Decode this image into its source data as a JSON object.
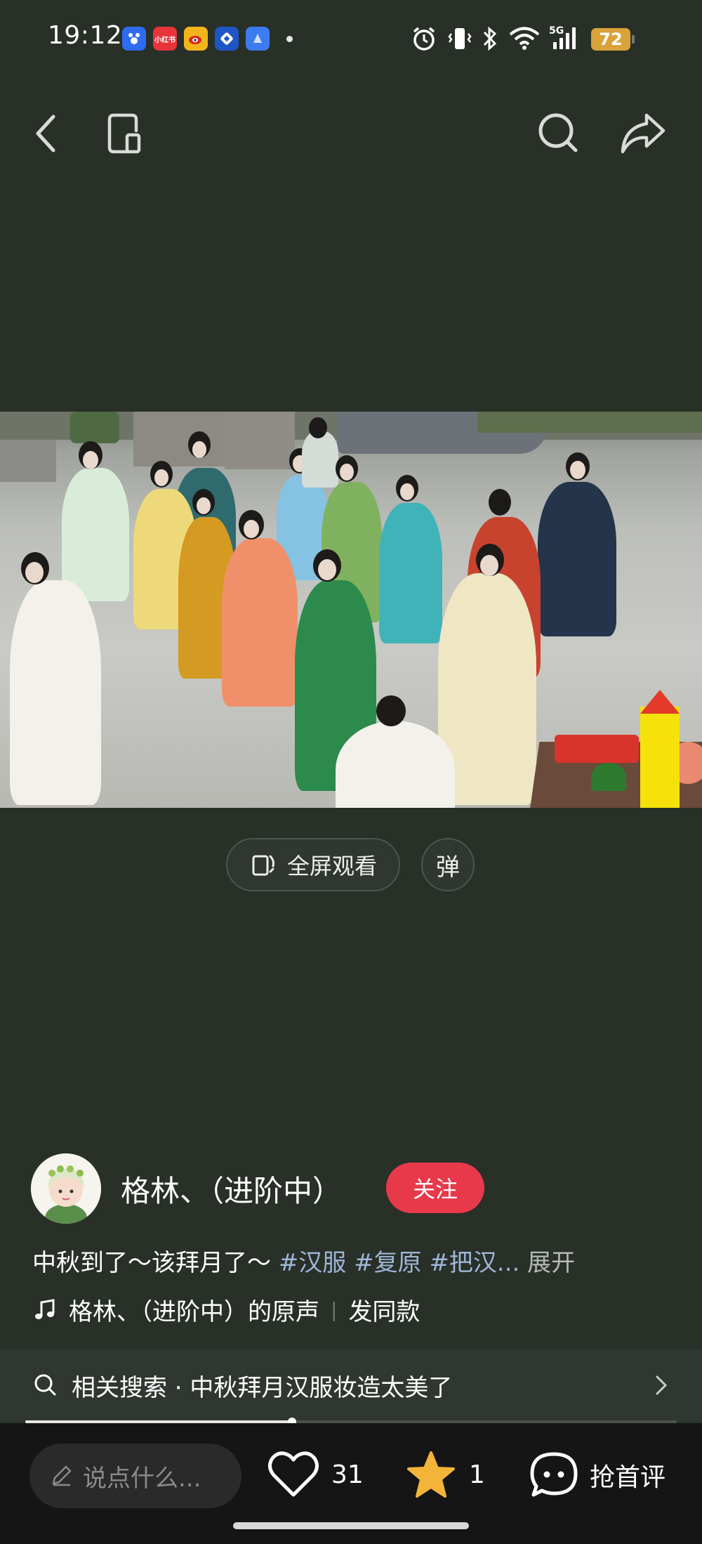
{
  "status_bar": {
    "time": "19:12",
    "battery": "72",
    "apps": [
      {
        "name": "baidu-app-icon",
        "label": "",
        "color": "#2f6bf0"
      },
      {
        "name": "xiaohongshu-app-icon",
        "label": "小红书",
        "color": "#e8333a"
      },
      {
        "name": "weibo-app-icon",
        "label": "",
        "color": "#f2b51b"
      },
      {
        "name": "ctrip-app-icon",
        "label": "",
        "color": "#1f56c6"
      },
      {
        "name": "blue-app-icon",
        "label": "",
        "color": "#3c7cf0"
      }
    ]
  },
  "nav": {
    "back_icon": "chevron-left-icon",
    "mini_window_icon": "mini-window-icon",
    "search_icon": "search-icon",
    "share_icon": "share-icon"
  },
  "player": {
    "fullscreen_label": "全屏观看",
    "danmu_label": "弹"
  },
  "post": {
    "author": "格林、（进阶中）",
    "follow_label": "关注",
    "description": "中秋到了～该拜月了～",
    "tags": [
      "#汉服",
      "#复原",
      "#把汉..."
    ],
    "expand_label": "展开",
    "music_title": "格林、（进阶中）的原声",
    "music_separator": "|",
    "use_sound_label": "发同款",
    "related_search": "相关搜索 · 中秋拜月汉服妆造太美了",
    "progress": 0.41
  },
  "bottom_bar": {
    "comment_placeholder": "说点什么...",
    "likes": "31",
    "favorites": "1",
    "first_comment_label": "抢首评"
  },
  "colors": {
    "background": "#283028",
    "follow_button": "#e8394a",
    "tag_text": "#9fb6d8",
    "star": "#f4b43a"
  }
}
